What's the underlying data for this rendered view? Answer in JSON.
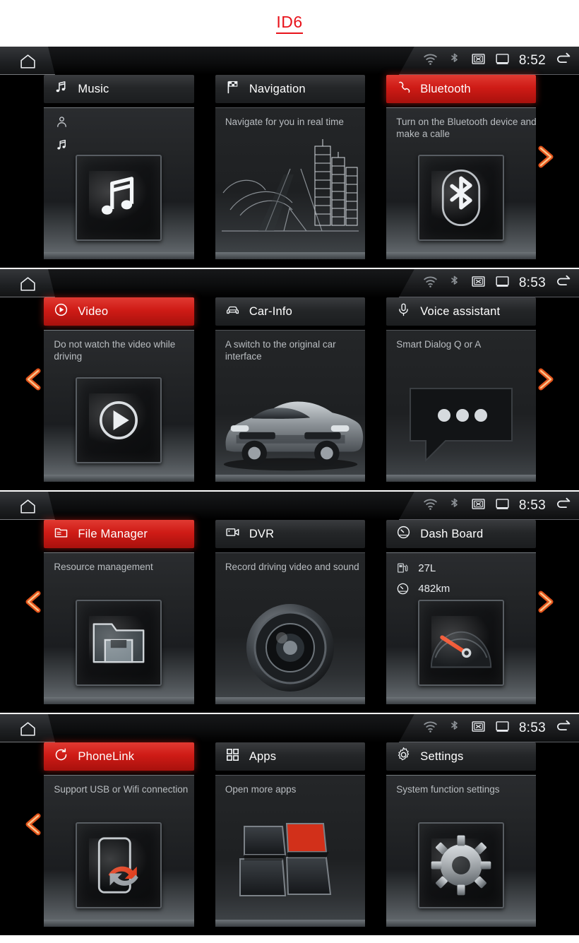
{
  "header": {
    "title": "ID6"
  },
  "theme": {
    "accent_red": "#cf1b16",
    "arrow_orange": "#f05a1e",
    "title_red": "#e8121a",
    "tile_text": "#b9bdc1"
  },
  "statusbar": {
    "home_icon": "home-icon",
    "icons": [
      "wifi-icon",
      "bluetooth-icon",
      "x-box-icon",
      "display-icon"
    ],
    "back_icon": "back-arrow-icon"
  },
  "panels": [
    {
      "time": "8:52",
      "has_left_arrow": false,
      "has_right_arrow": true,
      "tiles": [
        {
          "title": "Music",
          "icon": "music-note-icon",
          "active": false,
          "desc": "",
          "sub_icons": [
            "person-icon",
            "music-note-icon"
          ],
          "art": "music-note-art"
        },
        {
          "title": "Navigation",
          "icon": "checkered-flag-icon",
          "active": false,
          "desc": "Navigate for you in real time",
          "sub_icons": [],
          "art": "map-road-art"
        },
        {
          "title": "Bluetooth",
          "icon": "phone-handset-icon",
          "active": true,
          "desc": "Turn on the Bluetooth device and make a calle",
          "sub_icons": [],
          "art": "bluetooth-art"
        }
      ]
    },
    {
      "time": "8:53",
      "has_left_arrow": true,
      "has_right_arrow": true,
      "tiles": [
        {
          "title": "Video",
          "icon": "play-circle-icon",
          "active": true,
          "desc": "Do not watch the video while driving",
          "sub_icons": [],
          "art": "play-button-art"
        },
        {
          "title": "Car-Info",
          "icon": "car-front-icon",
          "active": false,
          "desc": "A switch to the original car interface",
          "sub_icons": [],
          "art": "car-photo-art"
        },
        {
          "title": "Voice assistant",
          "icon": "microphone-icon",
          "active": false,
          "desc": "Smart Dialog Q or A",
          "sub_icons": [],
          "art": "speech-bubble-art"
        }
      ]
    },
    {
      "time": "8:53",
      "has_left_arrow": true,
      "has_right_arrow": true,
      "tiles": [
        {
          "title": "File Manager",
          "icon": "folder-icon",
          "active": true,
          "desc": "Resource management",
          "sub_icons": [],
          "art": "folder-art"
        },
        {
          "title": "DVR",
          "icon": "video-camera-icon",
          "active": false,
          "desc": "Record driving video and sound",
          "sub_icons": [],
          "art": "camera-lens-art"
        },
        {
          "title": "Dash Board",
          "icon": "gauge-icon",
          "active": false,
          "desc": "",
          "sub_icons": [],
          "art": "speedometer-art",
          "stats": [
            {
              "icon": "fuel-pump-icon",
              "value": "27L"
            },
            {
              "icon": "gauge-icon",
              "value": "482km"
            }
          ]
        }
      ]
    },
    {
      "time": "8:53",
      "has_left_arrow": true,
      "has_right_arrow": false,
      "tiles": [
        {
          "title": "PhoneLink",
          "icon": "sync-circle-icon",
          "active": true,
          "desc": "Support USB or Wifi connection",
          "sub_icons": [],
          "art": "phone-sync-art"
        },
        {
          "title": "Apps",
          "icon": "grid-icon",
          "active": false,
          "desc": "Open more apps",
          "sub_icons": [],
          "art": "four-tiles-art"
        },
        {
          "title": "Settings",
          "icon": "gear-icon",
          "active": false,
          "desc": "System function settings",
          "sub_icons": [],
          "art": "gear-art"
        }
      ]
    }
  ]
}
